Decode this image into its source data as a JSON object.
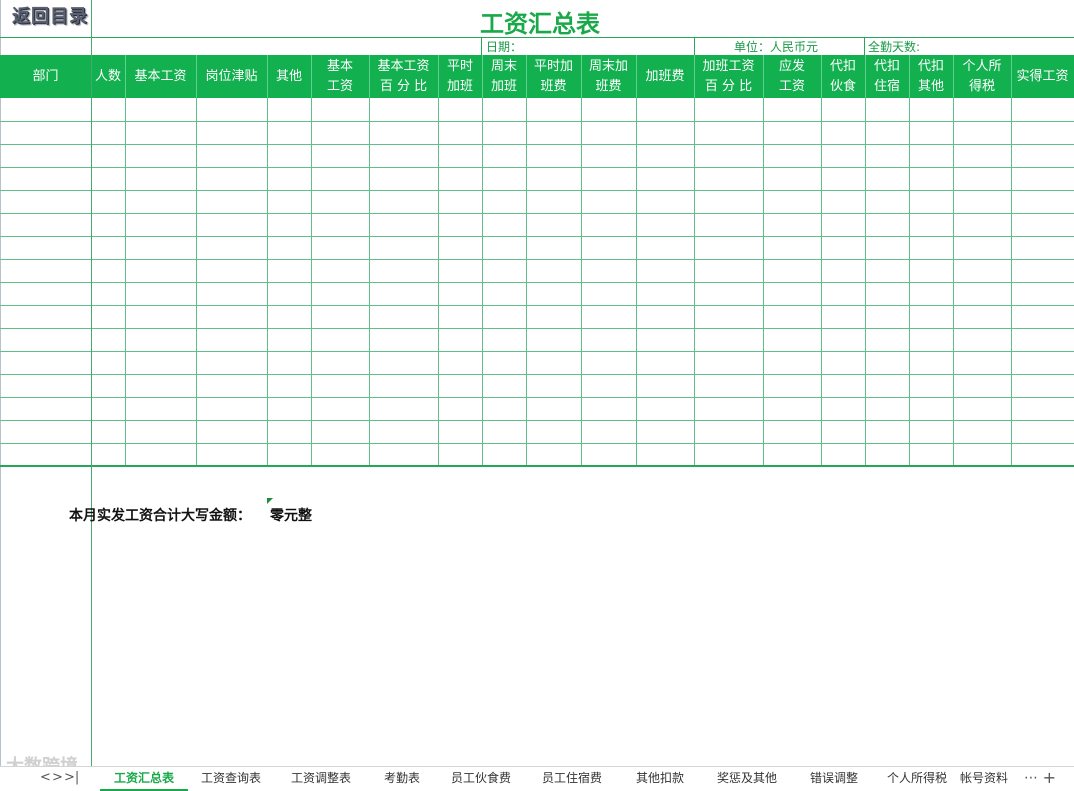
{
  "back_link": "返回目录",
  "title": "工资汇总表",
  "info": {
    "date_label": "日期：",
    "unit_label": "单位：人民币元",
    "attendance_label": "全勤天数:"
  },
  "columns": [
    "部门",
    "人数",
    "基本工资",
    "岗位津贴",
    "其他",
    "基本\n工资",
    "基本工资\n百 分 比",
    "平时\n加班",
    "周末\n加班",
    "平时加\n班费",
    "周末加\n班费",
    "加班费",
    "加班工资\n百 分 比",
    "应发\n工资",
    "代扣\n伙食",
    "代扣\n住宿",
    "代扣\n其他",
    "个人所\n得税",
    "实得工资"
  ],
  "total": {
    "label": "本月实发工资合计大写金额：",
    "value": "零元整"
  },
  "sheet_tabs": [
    "工资汇总表",
    "工资查询表",
    "工资调整表",
    "考勤表",
    "员工伙食费",
    "员工住宿费",
    "其他扣款",
    "奖惩及其他",
    "错误调整",
    "个人所得税",
    "帐号资料"
  ],
  "active_tab": "工资汇总表",
  "nav": {
    "prev": "<",
    "next": ">",
    "last": ">|",
    "more": "⋯",
    "add": "+"
  },
  "watermark": "大数跨境",
  "colors": {
    "header_bg": "#12b04f",
    "title": "#1aa94a",
    "grid_line": "#5fbf86"
  }
}
